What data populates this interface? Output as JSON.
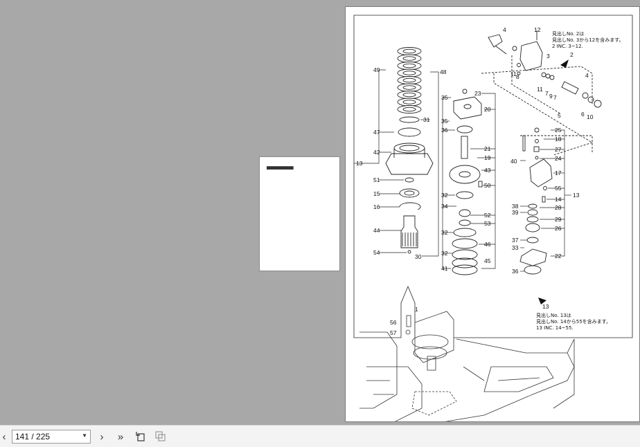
{
  "viewer": {
    "page_indicator": "141 / 225",
    "thumb_text": "████████████████████"
  },
  "toolbar": {
    "prev_icon": "chevron-left-icon",
    "next_icon": "chevron-right-icon",
    "last_icon": "double-chevron-right-icon",
    "rotate_icon": "rotate-page-icon",
    "copy_icon": "copy-page-icon"
  },
  "diagram": {
    "note_top": [
      "見出しNo. 2は",
      "見出しNo. 3から12を含みます。",
      "2 INC. 3~12."
    ],
    "note_bottom": [
      "見出しNo. 13は",
      "見出しNo. 14から55を含みます。",
      "13 INC. 14~55."
    ],
    "callouts_left": [
      "49",
      "48",
      "47",
      "42",
      "13",
      "51",
      "15",
      "16",
      "44",
      "54",
      "31",
      "30"
    ],
    "callouts_mid": [
      "35",
      "35",
      "36",
      "32",
      "34",
      "32",
      "32",
      "41",
      "23",
      "20",
      "21",
      "19",
      "43",
      "50",
      "52",
      "53",
      "46",
      "45"
    ],
    "callouts_top_right": [
      "4",
      "12",
      "3",
      "2",
      "11",
      "8",
      "11",
      "7",
      "9",
      "7",
      "4",
      "5",
      "6",
      "10"
    ],
    "callouts_right": [
      "25",
      "18",
      "27",
      "24",
      "40",
      "17",
      "55",
      "13",
      "14",
      "28",
      "38",
      "39",
      "29",
      "26",
      "37",
      "33",
      "22",
      "36",
      "13"
    ],
    "callouts_bottom": [
      "1",
      "56",
      "57"
    ]
  }
}
